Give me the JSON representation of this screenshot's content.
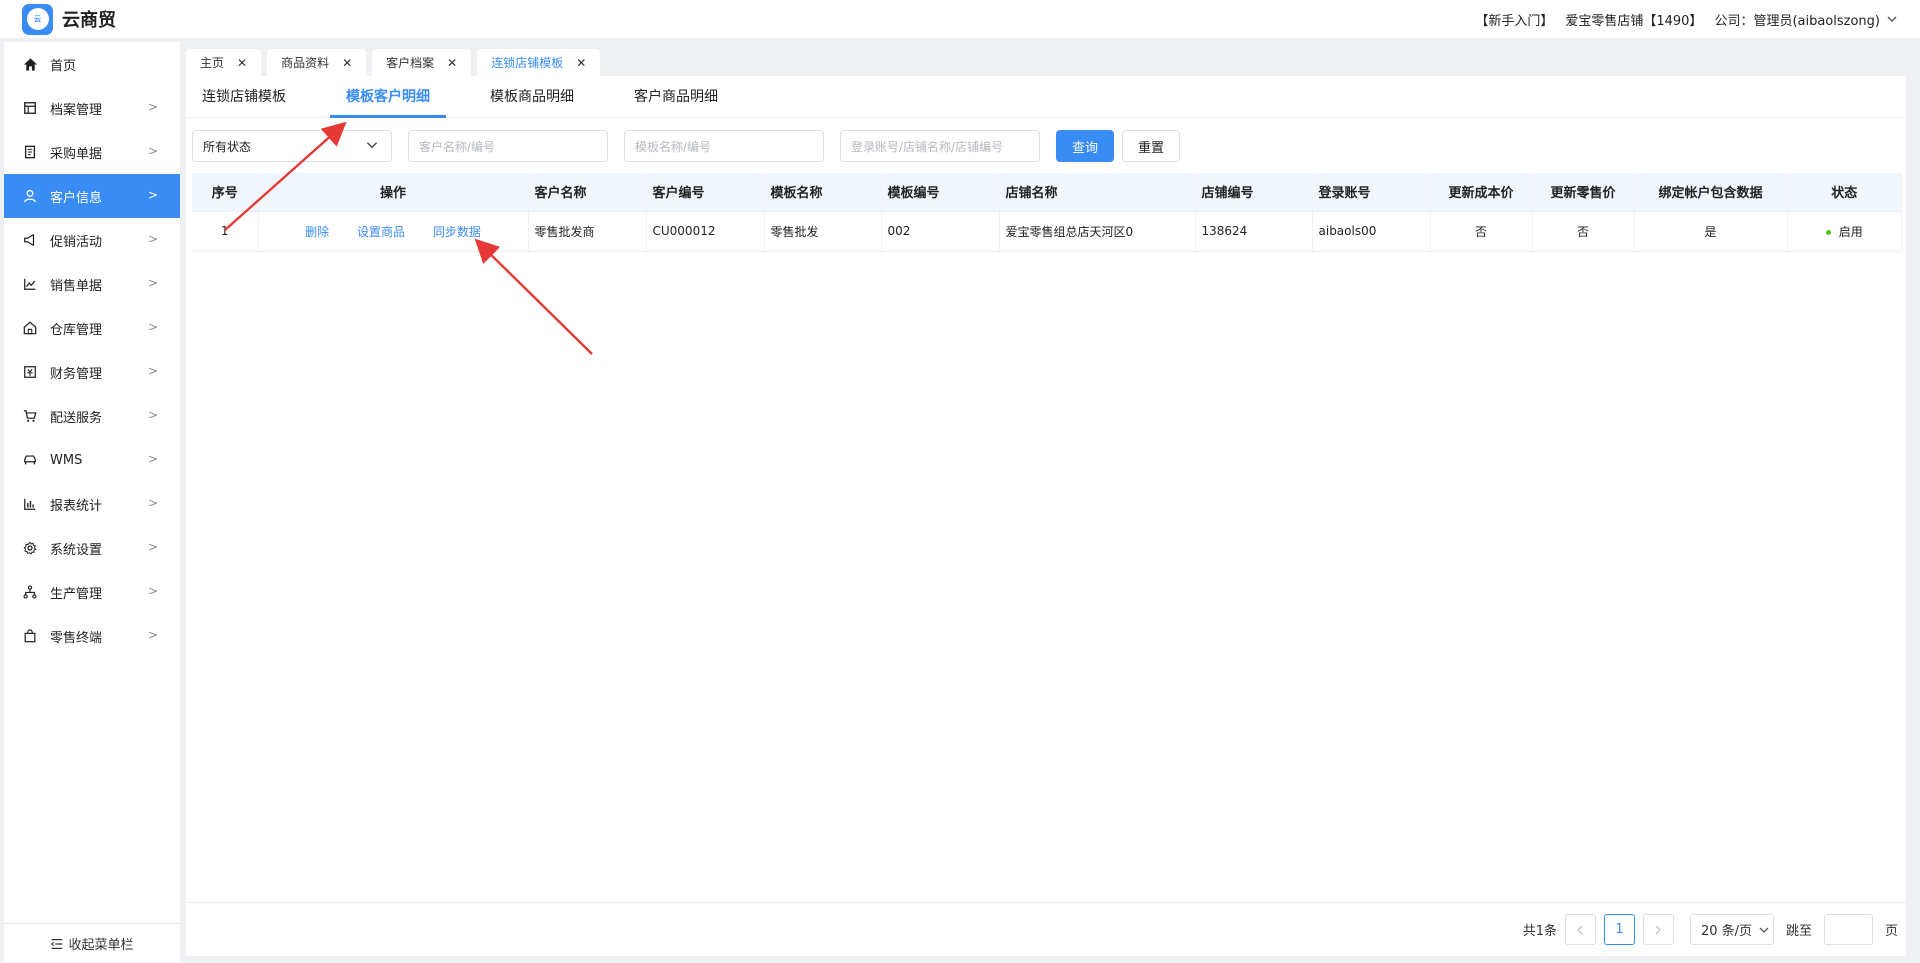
{
  "header": {
    "logo_text": "云商贸",
    "app_title": "云商贸",
    "links": [
      "【新手入门】",
      "爱宝零售店铺【1490】",
      "公司：管理员(aibaolszong)"
    ]
  },
  "sidebar": {
    "items": [
      {
        "label": "首页",
        "icon": "home-icon"
      },
      {
        "label": "档案管理",
        "icon": "archive-icon"
      },
      {
        "label": "采购单据",
        "icon": "purchase-doc-icon"
      },
      {
        "label": "客户信息",
        "icon": "user-icon"
      },
      {
        "label": "促销活动",
        "icon": "megaphone-icon"
      },
      {
        "label": "销售单据",
        "icon": "chart-line-icon"
      },
      {
        "label": "仓库管理",
        "icon": "warehouse-icon"
      },
      {
        "label": "财务管理",
        "icon": "finance-icon"
      },
      {
        "label": "配送服务",
        "icon": "cart-icon"
      },
      {
        "label": "WMS",
        "icon": "car-icon"
      },
      {
        "label": "报表统计",
        "icon": "bar-chart-icon"
      },
      {
        "label": "系统设置",
        "icon": "gear-icon"
      },
      {
        "label": "生产管理",
        "icon": "network-icon"
      },
      {
        "label": "零售终端",
        "icon": "bag-icon"
      }
    ],
    "active_index": 3,
    "collapse_label": "收起菜单栏"
  },
  "page_tabs": [
    {
      "label": "主页"
    },
    {
      "label": "商品资料"
    },
    {
      "label": "客户档案"
    },
    {
      "label": "连锁店铺模板"
    }
  ],
  "sub_tabs": [
    "连锁店铺模板",
    "模板客户明细",
    "模板商品明细",
    "客户商品明细"
  ],
  "filters": {
    "status_value": "所有状态",
    "customer_placeholder": "客户名称/编号",
    "template_placeholder": "模板名称/编号",
    "account_placeholder": "登录账号/店铺名称/店铺编号",
    "query_label": "查询",
    "reset_label": "重置"
  },
  "table": {
    "columns": [
      "序号",
      "操作",
      "客户名称",
      "客户编号",
      "模板名称",
      "模板编号",
      "店铺名称",
      "店铺编号",
      "登录账号",
      "更新成本价",
      "更新零售价",
      "绑定帐户包含数据",
      "状态"
    ],
    "rows": [
      {
        "index": "1",
        "actions": [
          "删除",
          "设置商品",
          "同步数据"
        ],
        "customer_name": "零售批发商",
        "customer_code": "CU000012",
        "template_name": "零售批发",
        "template_code": "002",
        "store_name": "爱宝零售组总店天河区0",
        "store_code": "138624",
        "login_account": "aibaols00",
        "update_cost": "否",
        "update_retail": "否",
        "bind_data": "是",
        "status": "启用"
      }
    ]
  },
  "pagination": {
    "total_text": "共1条",
    "current_page": "1",
    "page_size": "20 条/页",
    "jump_label": "跳至",
    "page_unit": "页"
  },
  "colors": {
    "accent": "#3a8cf5",
    "annotation_arrow": "#e53935",
    "status_dot": "#52c41a"
  }
}
